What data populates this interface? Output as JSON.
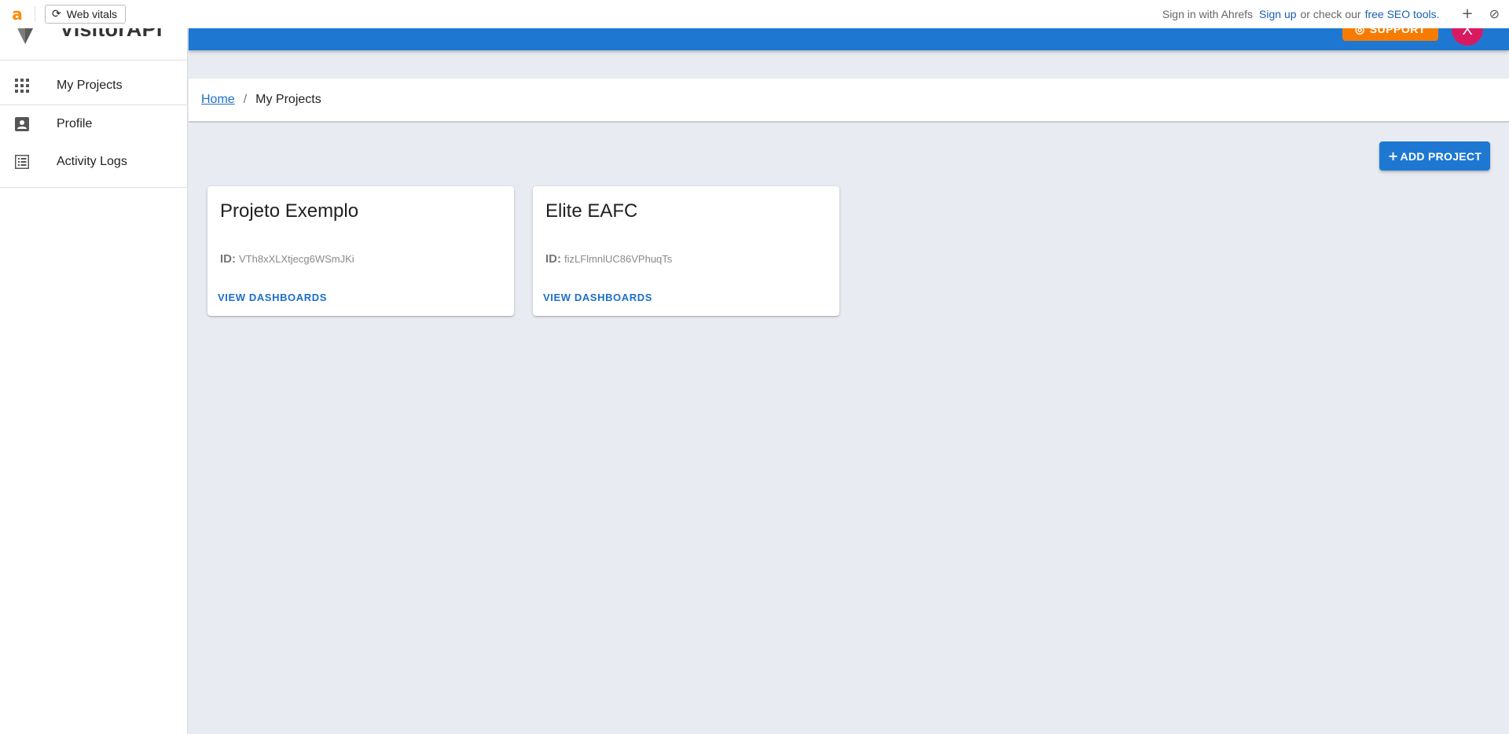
{
  "extension_bar": {
    "logo_letter": "a",
    "web_vitals_label": "Web vitals",
    "sign_in_text": "Sign in with Ahrefs",
    "sign_up_link": "Sign up",
    "middle_text": "or check our",
    "seo_tools_link": "free SEO tools.",
    "add_icon": "+",
    "block_icon": "⊘"
  },
  "sidebar": {
    "brand_name": "VisitorAPI",
    "items": [
      {
        "label": "My Projects",
        "icon": "apps-grid-icon"
      },
      {
        "label": "Profile",
        "icon": "account-box-icon"
      },
      {
        "label": "Activity Logs",
        "icon": "list-icon"
      }
    ]
  },
  "appbar": {
    "support_label": "SUPPORT",
    "avatar_letter": "X",
    "color": "#1e78d2"
  },
  "breadcrumb": {
    "home": "Home",
    "separator": "/",
    "current": "My Projects"
  },
  "actions": {
    "add_project_plus": "+",
    "add_project_label": "ADD PROJECT"
  },
  "projects": [
    {
      "name": "Projeto Exemplo",
      "id_label": "ID:",
      "id": "VTh8xXLXtjecg6WSmJKi",
      "action": "VIEW DASHBOARDS"
    },
    {
      "name": "Elite EAFC",
      "id_label": "ID:",
      "id": "fizLFlmnlUC86VPhuqTs",
      "action": "VIEW DASHBOARDS"
    }
  ]
}
